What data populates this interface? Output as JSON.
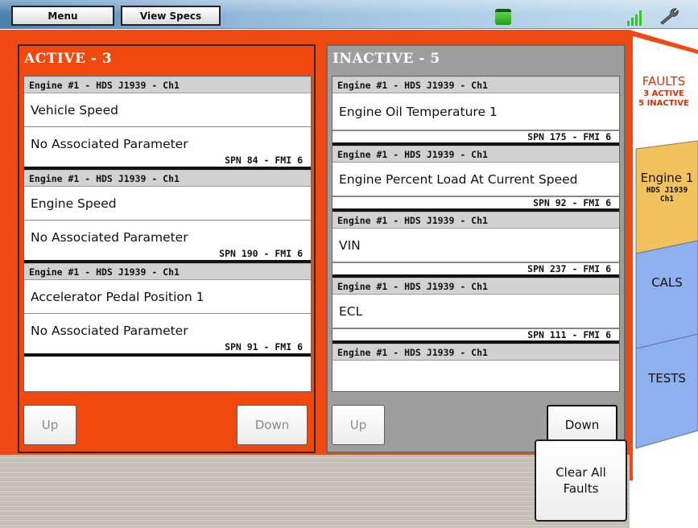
{
  "toolbar": {
    "menu_label": "Menu",
    "specs_label": "View Specs"
  },
  "active": {
    "title": "ACTIVE - 3",
    "faults": [
      {
        "source": "Engine #1 - HDS J1939 - Ch1",
        "name": "Vehicle Speed",
        "param": "No Associated Parameter",
        "code": "SPN 84 - FMI 6"
      },
      {
        "source": "Engine #1 - HDS J1939 - Ch1",
        "name": "Engine Speed",
        "param": "No Associated Parameter",
        "code": "SPN 190 - FMI 6"
      },
      {
        "source": "Engine #1 - HDS J1939 - Ch1",
        "name": "Accelerator Pedal Position 1",
        "param": "No Associated Parameter",
        "code": "SPN 91 - FMI 6"
      }
    ],
    "up_label": "Up",
    "down_label": "Down"
  },
  "inactive": {
    "title": "INACTIVE - 5",
    "faults": [
      {
        "source": "Engine #1 - HDS J1939 - Ch1",
        "name": "Engine Oil Temperature 1",
        "code": "SPN 175 - FMI 6"
      },
      {
        "source": "Engine #1 - HDS J1939 - Ch1",
        "name": "Engine Percent Load At Current Speed",
        "code": "SPN 92 - FMI 6"
      },
      {
        "source": "Engine #1 - HDS J1939 - Ch1",
        "name": "VIN",
        "code": "SPN 237 - FMI 6"
      },
      {
        "source": "Engine #1 - HDS J1939 - Ch1",
        "name": "ECL",
        "code": "SPN 111 - FMI 6"
      },
      {
        "source": "Engine #1 - HDS J1939 - Ch1"
      }
    ],
    "up_label": "Up",
    "down_label": "Down"
  },
  "clear_all_label": "Clear All\nFaults",
  "tabs": {
    "faults": {
      "title": "FAULTS",
      "line1": "3 ACTIVE",
      "line2": "5 INACTIVE"
    },
    "engine": {
      "title": "Engine 1",
      "line1": "HDS J1939",
      "line2": "Ch1"
    },
    "cals": {
      "title": "CALS"
    },
    "tests": {
      "title": "TESTS"
    }
  },
  "colors": {
    "active_bg": "#f04a14",
    "inactive_bg": "#9e9e9e",
    "engine_tab": "#f2c25c",
    "blue_tab": "#8fb0ee"
  }
}
